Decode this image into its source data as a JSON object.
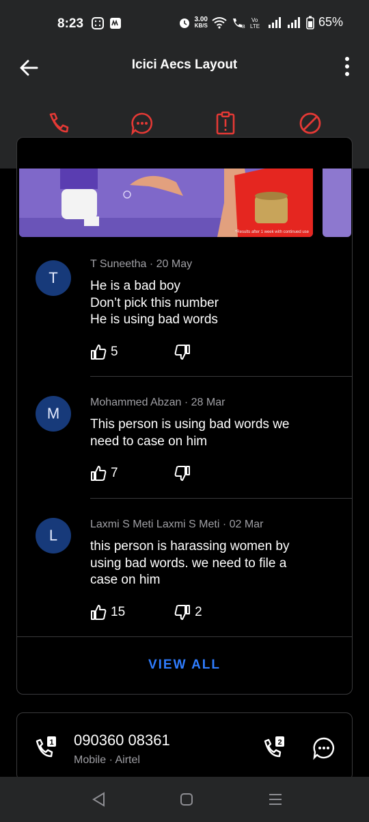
{
  "status": {
    "time": "8:23",
    "speed_top": "3.00",
    "speed_bottom": "KB/S",
    "battery": "65%"
  },
  "appbar": {
    "title": "Icici Aecs Layout"
  },
  "ad": {
    "caption": "*Results after 1 week with continued use"
  },
  "reviews": [
    {
      "initial": "T",
      "author": "T Suneetha",
      "date": "20 May",
      "lines": [
        "He is a bad boy",
        "Don’t pick this number",
        "He is using bad words"
      ],
      "likes": "5",
      "dislikes": ""
    },
    {
      "initial": "M",
      "author": "Mohammed Abzan",
      "date": "28 Mar",
      "lines": [
        "This person is using bad words we",
        "need to case on him"
      ],
      "likes": "7",
      "dislikes": ""
    },
    {
      "initial": "L",
      "author": "Laxmi S Meti Laxmi S Meti",
      "date": "02 Mar",
      "lines": [
        "this person is harassing women by",
        "using bad words. we need to file a",
        "case on him"
      ],
      "likes": "15",
      "dislikes": "2"
    }
  ],
  "view_all": "VIEW ALL",
  "number": {
    "value": "090360 08361",
    "sub": "Mobile · Airtel",
    "sim1": "1",
    "sim2": "2"
  },
  "colors": {
    "accent_red": "#e53935",
    "link_blue": "#2f7dff",
    "avatar_bg": "#173a7a",
    "bar_bg": "#252627"
  }
}
